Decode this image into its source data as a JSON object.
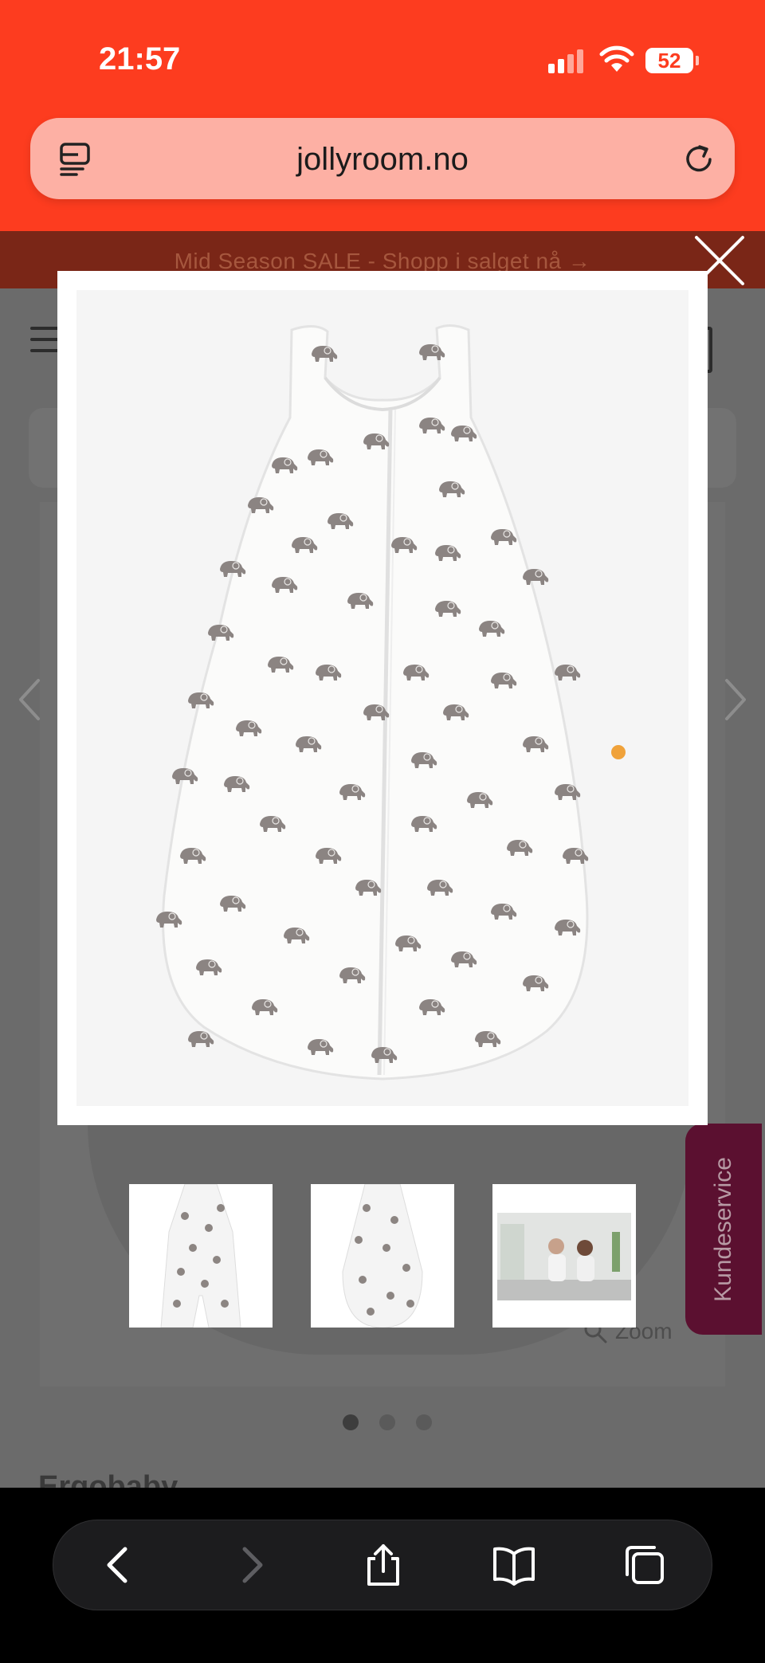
{
  "status_bar": {
    "time": "21:57",
    "battery": "52"
  },
  "browser": {
    "url": "jollyroom.no"
  },
  "page": {
    "promo_banner": "Mid Season SALE - Shopp i salget nå →",
    "zoom_label": "Zoom",
    "brand_peek": "Ergobaby",
    "support_tab": "Kundeservice",
    "carousel": {
      "dots": 3,
      "active_index": 0
    }
  },
  "lightbox": {
    "image_alt": "sleeping-bag-elephant-print",
    "thumbnails": [
      "sleeping-bag-with-legs",
      "sleeping-bag-round",
      "lifestyle-photo"
    ]
  },
  "colors": {
    "brand_orange": "#fd3c1f",
    "support_tab": "#5b1030"
  },
  "toolbar": {
    "buttons": [
      "back",
      "forward",
      "share",
      "bookmarks",
      "tabs"
    ]
  }
}
